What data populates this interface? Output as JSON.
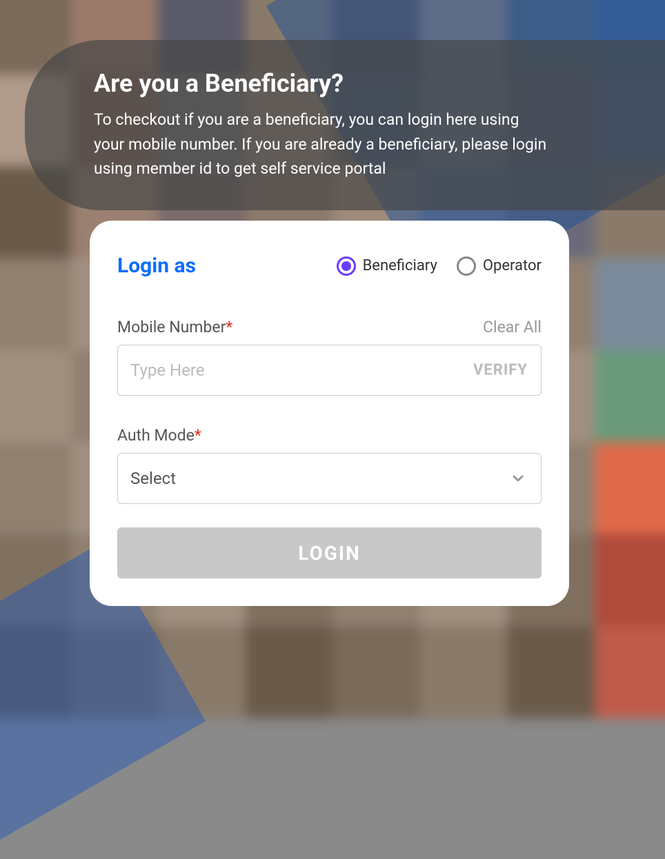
{
  "banner": {
    "title": "Are you a Beneficiary?",
    "description": "To checkout if you are a beneficiary, you can login here using your mobile number. If you are already a beneficiary, please login using member id to get self service portal"
  },
  "card": {
    "login_as_label": "Login as",
    "radio_options": {
      "beneficiary": "Beneficiary",
      "operator": "Operator"
    },
    "selected_option": "beneficiary",
    "mobile": {
      "label": "Mobile Number",
      "placeholder": "Type Here",
      "value": "",
      "verify_label": "VERIFY"
    },
    "clear_all_label": "Clear All",
    "auth_mode": {
      "label": "Auth Mode",
      "selected": "Select"
    },
    "login_button_label": "LOGIN"
  },
  "bg_colors": [
    "#7a6a5a",
    "#9a7a6a",
    "#5a5a6a",
    "#8a7a6a",
    "#6a5a5a",
    "#a08a7a",
    "#5a6a7a",
    "#4a6a9a",
    "#b09a8a",
    "#8a6a5a",
    "#7a7a7a",
    "#9a8a7a",
    "#6a6a6a",
    "#a09080",
    "#7a6a6a",
    "#5a7a9a",
    "#6a5a4a",
    "#9a8070",
    "#7a6a6a",
    "#8a7a6a",
    "#a08a7a",
    "#7a7a8a",
    "#6a6a7a",
    "#8a7a6a",
    "#908070",
    "#a09080",
    "#807060",
    "#908070",
    "#a09080",
    "#807060",
    "#908070",
    "#7a8a9a",
    "#a09080",
    "#908070",
    "#807060",
    "#a09080",
    "#908070",
    "#807060",
    "#a09080",
    "#6a9a7a",
    "#908070",
    "#a09080",
    "#807060",
    "#908070",
    "#a09080",
    "#807060",
    "#908070",
    "#e06a4a",
    "#807060",
    "#908070",
    "#a09080",
    "#807060",
    "#908070",
    "#a09080",
    "#807060",
    "#b04a3a",
    "#6a5a4a",
    "#7a6a5a",
    "#8a7a6a",
    "#6a5a4a",
    "#7a6a5a",
    "#8a7a6a",
    "#6a5a4a",
    "#c05a4a"
  ]
}
